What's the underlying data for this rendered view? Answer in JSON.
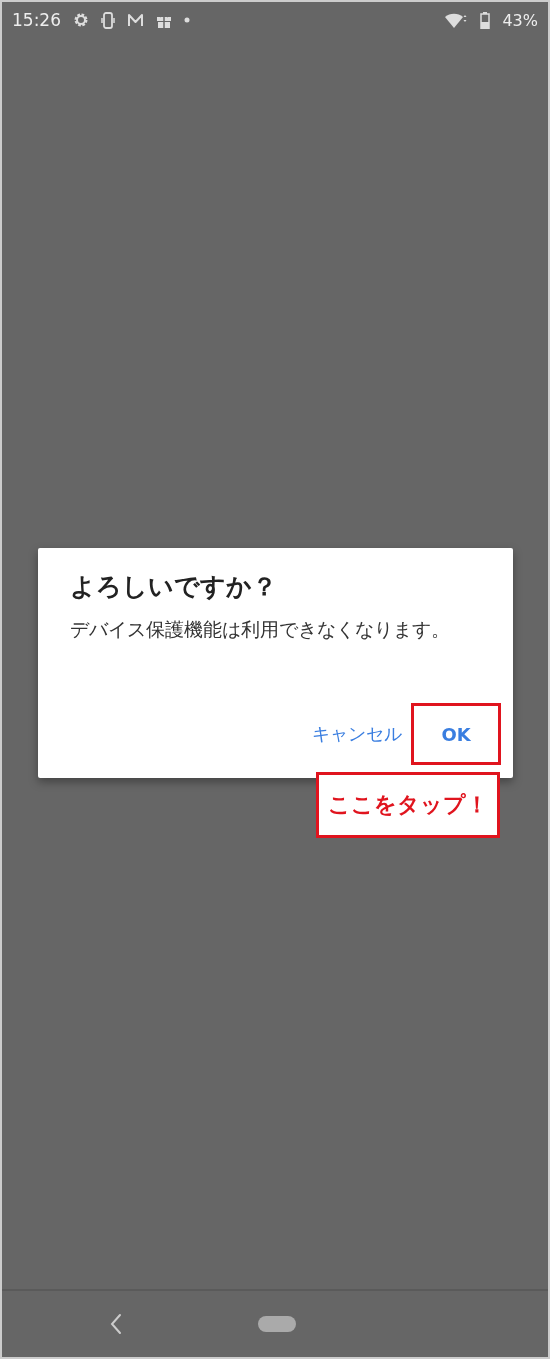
{
  "status_bar": {
    "time": "15:26",
    "battery": "43%"
  },
  "dialog": {
    "title": "よろしいですか？",
    "message": "デバイス保護機能は利用できなくなります。",
    "buttons": [
      {
        "label": "キャンセル",
        "highlighted": false
      },
      {
        "label": "OK",
        "highlighted": true
      }
    ]
  },
  "annotation": {
    "text": "ここをタップ！"
  }
}
